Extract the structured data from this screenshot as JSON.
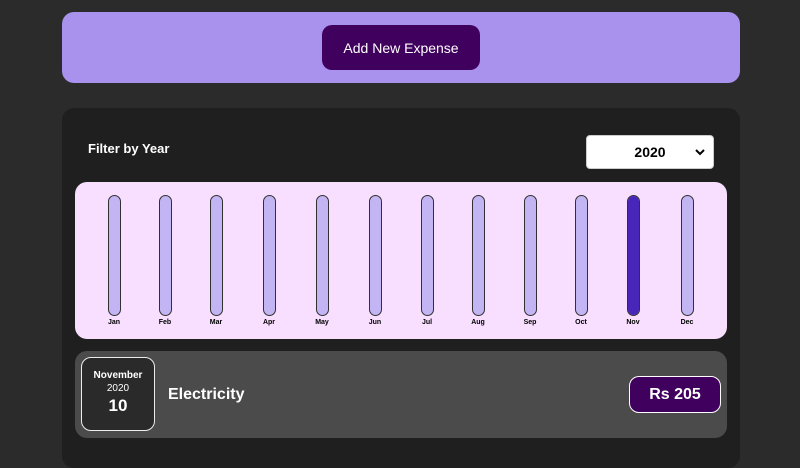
{
  "new_expense": {
    "button_label": "Add New Expense"
  },
  "filter": {
    "label": "Filter by Year",
    "selected_year": "2020"
  },
  "chart_data": {
    "type": "bar",
    "categories": [
      "Jan",
      "Feb",
      "Mar",
      "Apr",
      "May",
      "Jun",
      "Jul",
      "Aug",
      "Sep",
      "Oct",
      "Nov",
      "Dec"
    ],
    "values": [
      0,
      0,
      0,
      0,
      0,
      0,
      0,
      0,
      0,
      0,
      205,
      0
    ],
    "max": 205
  },
  "expenses": [
    {
      "month": "November",
      "year": "2020",
      "day": "10",
      "title": "Electricity",
      "amount": "Rs 205"
    }
  ],
  "colors": {
    "background": "#2b2b2b",
    "header_panel": "#a892ee",
    "accent_dark_purple": "#40005d",
    "chart_background": "#f8dfff",
    "bar_empty": "#c3b4f3",
    "bar_fill": "#4826b9",
    "item_background": "#4b4b4b"
  }
}
